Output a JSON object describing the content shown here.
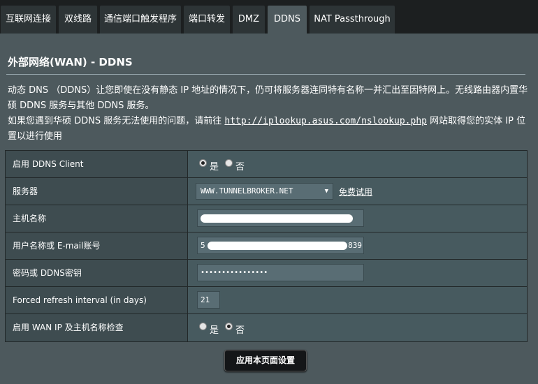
{
  "tabs": [
    {
      "label": "互联网连接"
    },
    {
      "label": "双线路"
    },
    {
      "label": "通信端口触发程序"
    },
    {
      "label": "端口转发"
    },
    {
      "label": "DMZ"
    },
    {
      "label": "DDNS"
    },
    {
      "label": "NAT Passthrough"
    }
  ],
  "active_tab": "DDNS",
  "page": {
    "title": "外部网络(WAN) - DDNS",
    "desc1": "动态 DNS （DDNS）让您即使在没有静态 IP 地址的情况下，仍可将服务器连同特有名称一并汇出至因特网上。无线路由器内置华硕 DDNS 服务与其他 DDNS 服务。",
    "desc2_prefix": "如果您遇到华硕 DDNS 服务无法使用的问题，请前往 ",
    "desc2_link": "http://iplookup.asus.com/nslookup.php",
    "desc2_suffix": " 网站取得您的实体 IP 位置以进行使用"
  },
  "form": {
    "enable_label": "启用 DDNS Client",
    "yes": "是",
    "no": "否",
    "enable_value": "是",
    "server_label": "服务器",
    "server_value": "WWW.TUNNELBROKER.NET",
    "free_trial": "免费试用",
    "hostname_label": "主机名称",
    "hostname_value": "",
    "username_label": "用户名称或 E-mail账号",
    "username_prefix": "5",
    "username_suffix": "839",
    "password_label": "密码或 DDNS密钥",
    "password_value": "••••••••••••••••",
    "refresh_label": "Forced refresh interval (in days)",
    "refresh_value": "21",
    "wancheck_label": "启用 WAN IP 及主机名称检查",
    "wancheck_value": "否"
  },
  "apply_label": "应用本页面设置"
}
